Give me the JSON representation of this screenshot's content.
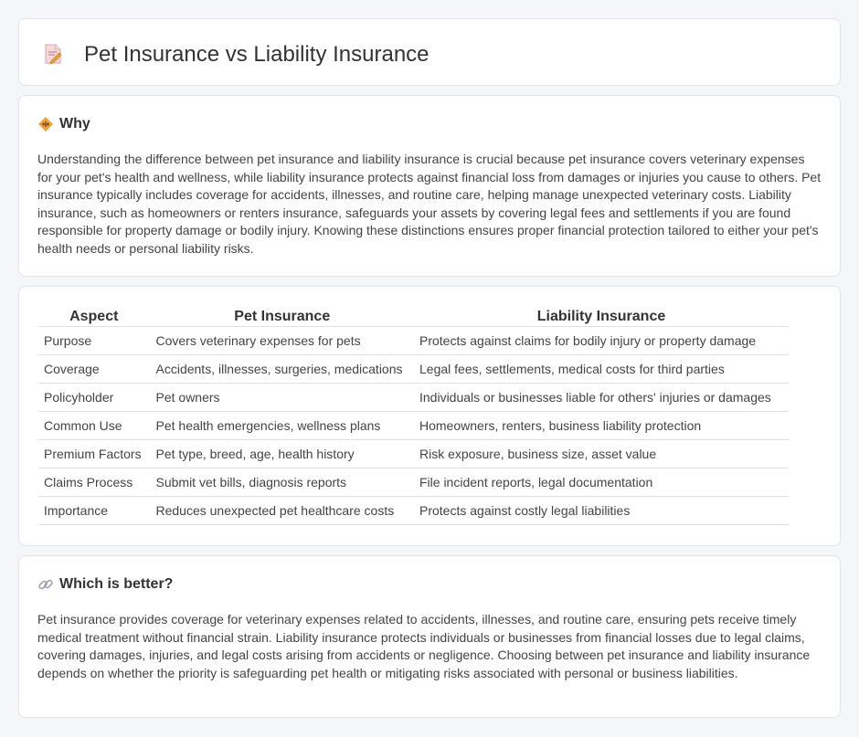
{
  "header": {
    "title": "Pet Insurance vs Liability Insurance",
    "icon": "document-pencil-icon"
  },
  "why": {
    "title": "Why",
    "icon": "diamond-warning-icon",
    "text": "Understanding the difference between pet insurance and liability insurance is crucial because pet insurance covers veterinary expenses for your pet's health and wellness, while liability insurance protects against financial loss from damages or injuries you cause to others. Pet insurance typically includes coverage for accidents, illnesses, and routine care, helping manage unexpected veterinary costs. Liability insurance, such as homeowners or renters insurance, safeguards your assets by covering legal fees and settlements if you are found responsible for property damage or bodily injury. Knowing these distinctions ensures proper financial protection tailored to either your pet's health needs or personal liability risks."
  },
  "comparison": {
    "headers": [
      "Aspect",
      "Pet Insurance",
      "Liability Insurance"
    ],
    "rows": [
      [
        "Purpose",
        "Covers veterinary expenses for pets",
        "Protects against claims for bodily injury or property damage"
      ],
      [
        "Coverage",
        "Accidents, illnesses, surgeries, medications",
        "Legal fees, settlements, medical costs for third parties"
      ],
      [
        "Policyholder",
        "Pet owners",
        "Individuals or businesses liable for others' injuries or damages"
      ],
      [
        "Common Use",
        "Pet health emergencies, wellness plans",
        "Homeowners, renters, business liability protection"
      ],
      [
        "Premium Factors",
        "Pet type, breed, age, health history",
        "Risk exposure, business size, asset value"
      ],
      [
        "Claims Process",
        "Submit vet bills, diagnosis reports",
        "File incident reports, legal documentation"
      ],
      [
        "Importance",
        "Reduces unexpected pet healthcare costs",
        "Protects against costly legal liabilities"
      ]
    ]
  },
  "better": {
    "title": "Which is better?",
    "icon": "link-icon",
    "text": "Pet insurance provides coverage for veterinary expenses related to accidents, illnesses, and routine care, ensuring pets receive timely medical treatment without financial strain. Liability insurance protects individuals or businesses from financial losses due to legal claims, covering damages, injuries, and legal costs arising from accidents or negligence. Choosing between pet insurance and liability insurance depends on whether the priority is safeguarding pet health or mitigating risks associated with personal or business liabilities."
  },
  "colors": {
    "background": "#f5f6f8",
    "card": "#ffffff",
    "border": "#e2e4e8",
    "icon_orange": "#f0a23a",
    "icon_pink": "#e77b8a"
  }
}
